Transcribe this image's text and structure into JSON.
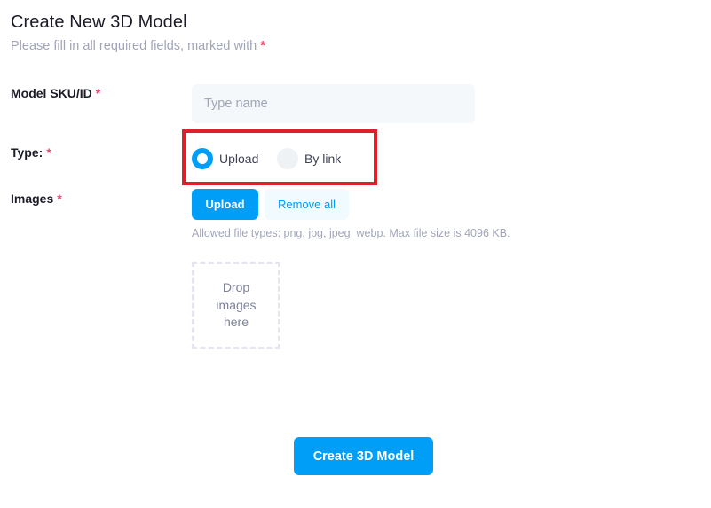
{
  "header": {
    "title": "Create New 3D Model",
    "subtitle": "Please fill in all required fields, marked with",
    "required_marker": "*"
  },
  "form": {
    "sku": {
      "label": "Model SKU/ID",
      "required_marker": "*",
      "placeholder": "Type name",
      "value": ""
    },
    "type": {
      "label": "Type:",
      "required_marker": "*",
      "options": [
        {
          "label": "Upload",
          "checked": true
        },
        {
          "label": "By link",
          "checked": false
        }
      ]
    },
    "images": {
      "label": "Images",
      "required_marker": "*",
      "upload_label": "Upload",
      "remove_all_label": "Remove all",
      "hint": "Allowed file types: png, jpg, jpeg, webp. Max file size is 4096 KB.",
      "dropzone_text": "Drop images here"
    },
    "submit_label": "Create 3D Model"
  },
  "colors": {
    "accent": "#009ef7",
    "required": "#f1416c",
    "highlight": "#e01f2c",
    "muted_text": "#a1a5b7"
  }
}
